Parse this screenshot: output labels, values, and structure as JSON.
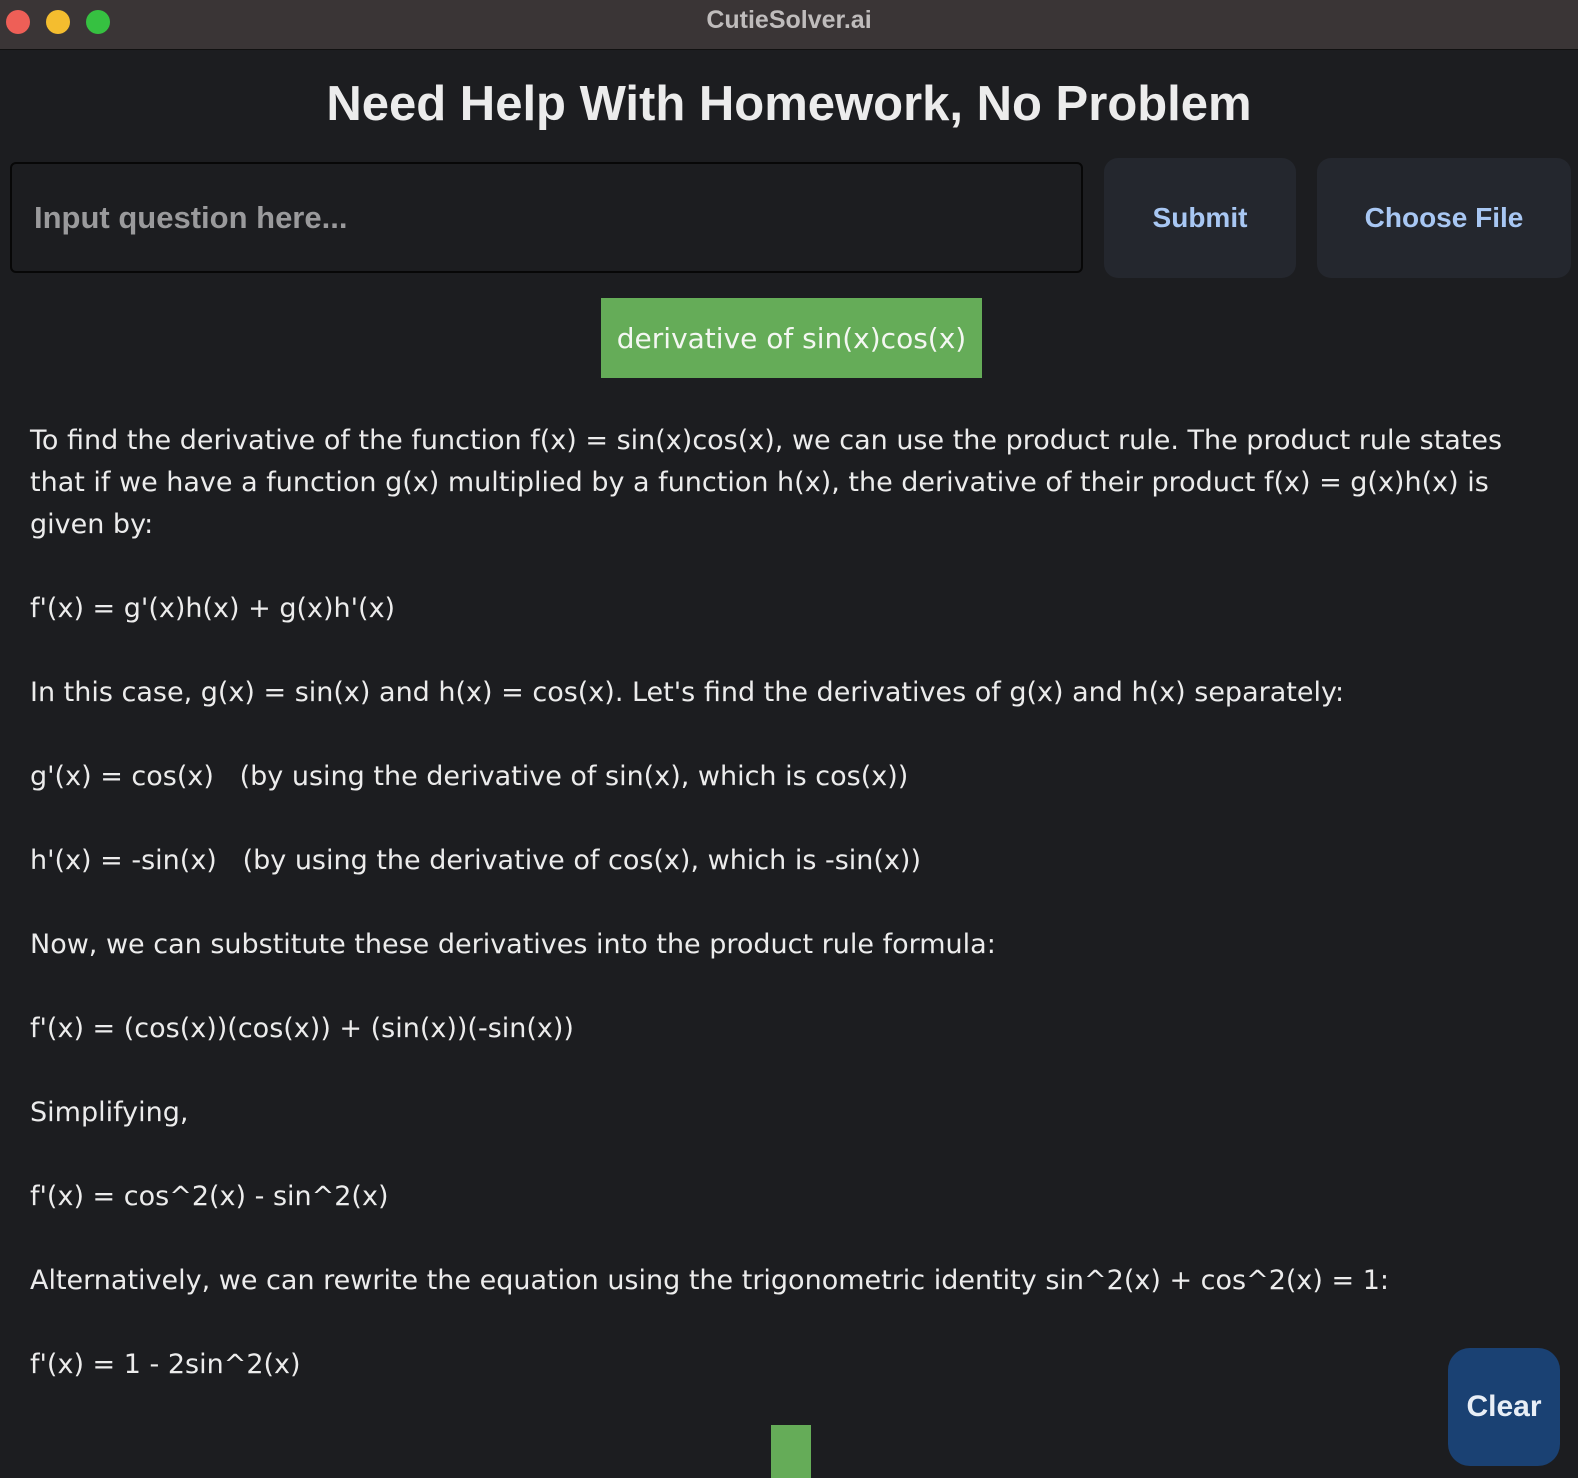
{
  "window": {
    "title": "CutieSolver.ai"
  },
  "page": {
    "heading": "Need Help With Homework, No Problem"
  },
  "question_input": {
    "value": "",
    "placeholder": "Input question here..."
  },
  "buttons": {
    "submit": "Submit",
    "choose_file": "Choose File",
    "clear": "Clear"
  },
  "query": {
    "text": "derivative of sin(x)cos(x)"
  },
  "answer": {
    "paragraphs": [
      "To find the derivative of the function f(x) = sin(x)cos(x), we can use the product rule. The product rule states that if we have a function g(x) multiplied by a function h(x), the derivative of their product f(x) = g(x)h(x) is given by:",
      "f'(x) = g'(x)h(x) + g(x)h'(x)",
      "In this case, g(x) = sin(x) and h(x) = cos(x). Let's find the derivatives of g(x) and h(x) separately:",
      "g'(x) = cos(x)   (by using the derivative of sin(x), which is cos(x))",
      "h'(x) = -sin(x)   (by using the derivative of cos(x), which is -sin(x))",
      "Now, we can substitute these derivatives into the product rule formula:",
      "f'(x) = (cos(x))(cos(x)) + (sin(x))(-sin(x))",
      "Simplifying,",
      "f'(x) = cos^2(x) - sin^2(x)",
      "Alternatively, we can rewrite the equation using the trigonometric identity sin^2(x) + cos^2(x) = 1:",
      "f'(x) = 1 - 2sin^2(x)"
    ]
  },
  "colors": {
    "background": "#1c1d20",
    "titlebar": "#3a3536",
    "accent_green": "#65ac58",
    "button_bg": "#24272e",
    "button_text": "#a8c7f3",
    "clear_button": "#1a4173"
  }
}
